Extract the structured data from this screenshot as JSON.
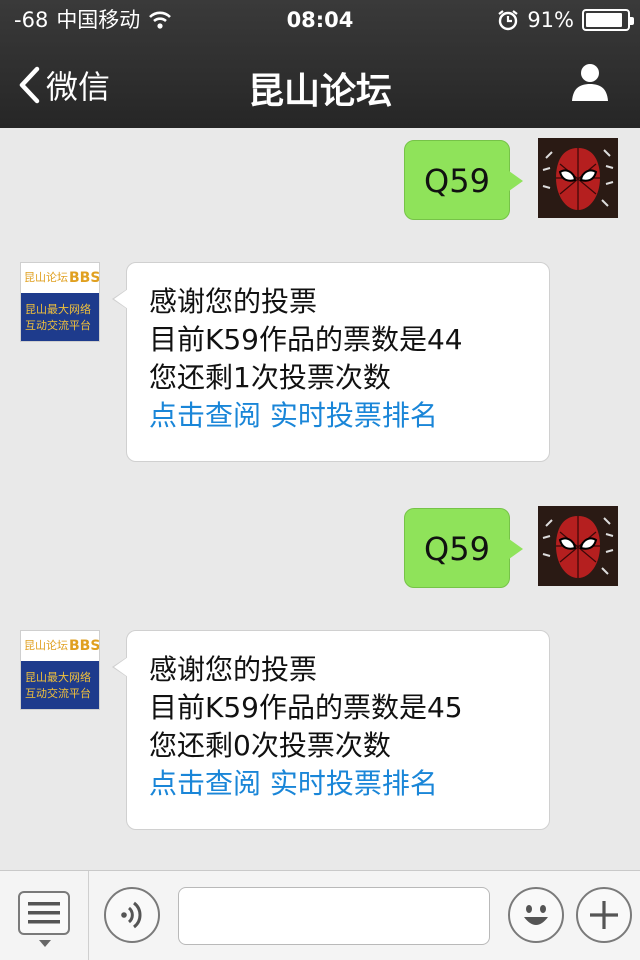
{
  "status": {
    "signal": "-68",
    "carrier": "中国移动",
    "time": "08:04",
    "battery": "91%",
    "battery_level": 0.91
  },
  "nav": {
    "back_label": "微信",
    "title": "昆山论坛"
  },
  "messages": [
    {
      "type": "outgoing",
      "text": "Q59"
    },
    {
      "type": "incoming",
      "line1": "感谢您的投票",
      "line2": "目前K59作品的票数是44",
      "line3": "您还剩1次投票次数",
      "link1": "点击查阅",
      "link2": "实时投票排名"
    },
    {
      "type": "outgoing",
      "text": "Q59"
    },
    {
      "type": "incoming",
      "line1": "感谢您的投票",
      "line2": "目前K59作品的票数是45",
      "line3": "您还剩0次投票次数",
      "link1": "点击查阅",
      "link2": "实时投票排名"
    }
  ],
  "bbs_avatar": {
    "brand": "昆山论坛",
    "brand_en": "BBS",
    "tagline1": "昆山最大网络",
    "tagline2": "互动交流平台"
  },
  "input": {
    "value": "",
    "placeholder": ""
  },
  "icons": {
    "back": "chevron-left-icon",
    "profile": "person-icon",
    "menu": "list-menu-icon",
    "voice": "voice-icon",
    "emoji": "smiley-icon",
    "add": "plus-icon"
  },
  "colors": {
    "outgoing_bubble": "#8fe35a",
    "incoming_bubble": "#ffffff",
    "link": "#1a86d8",
    "nav_bg": "#2b2b2b"
  }
}
